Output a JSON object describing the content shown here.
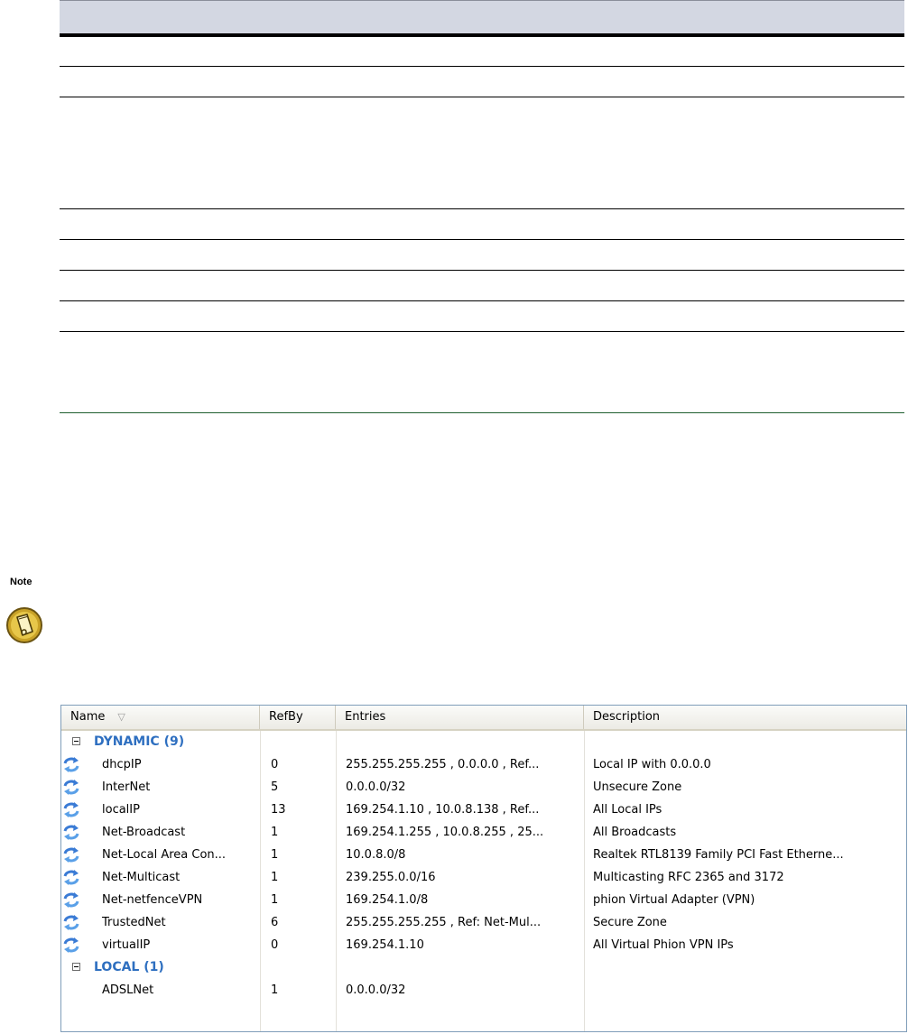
{
  "note": {
    "label": "Note",
    "icon": "note-icon"
  },
  "netlist": {
    "columns": {
      "name": "Name",
      "refby": "RefBy",
      "entries": "Entries",
      "description": "Description"
    },
    "sort_icon": "sort-descending-icon",
    "groups": [
      {
        "label": "DYNAMIC (9)",
        "items": [
          {
            "name": "dhcpIP",
            "refby": "0",
            "entries": "255.255.255.255 , 0.0.0.0 , Ref...",
            "description": "Local IP with 0.0.0.0"
          },
          {
            "name": "InterNet",
            "refby": "5",
            "entries": "0.0.0.0/32",
            "description": "Unsecure Zone"
          },
          {
            "name": "localIP",
            "refby": "13",
            "entries": "169.254.1.10 , 10.0.8.138 , Ref...",
            "description": "All Local IPs"
          },
          {
            "name": "Net-Broadcast",
            "refby": "1",
            "entries": "169.254.1.255 , 10.0.8.255 , 25...",
            "description": "All Broadcasts"
          },
          {
            "name": "Net-Local Area Con...",
            "refby": "1",
            "entries": "10.0.8.0/8",
            "description": "Realtek RTL8139 Family PCI Fast Etherne..."
          },
          {
            "name": "Net-Multicast",
            "refby": "1",
            "entries": "239.255.0.0/16",
            "description": "Multicasting RFC 2365 and 3172"
          },
          {
            "name": "Net-netfenceVPN",
            "refby": "1",
            "entries": "169.254.1.0/8",
            "description": "phion Virtual Adapter (VPN)"
          },
          {
            "name": "TrustedNet",
            "refby": "6",
            "entries": "255.255.255.255 , Ref: Net-Mul...",
            "description": "Secure Zone"
          },
          {
            "name": "virtualIP",
            "refby": "0",
            "entries": "169.254.1.10",
            "description": "All Virtual Phion VPN IPs"
          }
        ]
      },
      {
        "label": "LOCAL (1)",
        "items": [
          {
            "name": "ADSLNet",
            "refby": "1",
            "entries": "0.0.0.0/32",
            "description": ""
          }
        ]
      }
    ]
  }
}
